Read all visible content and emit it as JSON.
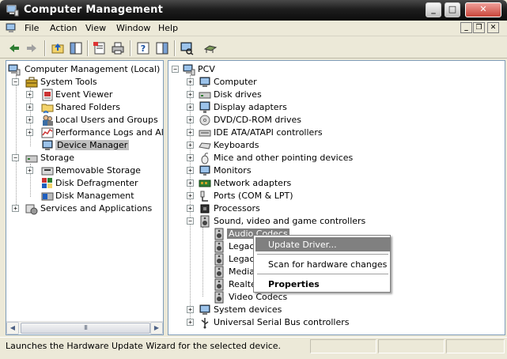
{
  "window": {
    "title": "Computer Management",
    "controls": {
      "minimize": "_",
      "maximize": "□",
      "close": "✕"
    }
  },
  "menubar": {
    "items": [
      "File",
      "Action",
      "View",
      "Window",
      "Help"
    ],
    "mdi_controls": {
      "minimize": "_",
      "restore": "❐",
      "close": "✕"
    }
  },
  "toolbar": {
    "buttons": [
      "back-icon",
      "forward-icon",
      "up-icon",
      "show-hide-tree-icon",
      "properties-icon",
      "print-icon",
      "help-icon",
      "action-pane-icon",
      "scan-hardware-icon",
      "remove-device-icon"
    ]
  },
  "left_tree": {
    "nodes": [
      {
        "label": "Computer Management (Local)",
        "icon": "computer-management-icon"
      },
      {
        "label": "System Tools",
        "icon": "toolbox-icon"
      },
      {
        "label": "Event Viewer",
        "icon": "event-viewer-icon"
      },
      {
        "label": "Shared Folders",
        "icon": "shared-folder-icon"
      },
      {
        "label": "Local Users and Groups",
        "icon": "users-icon"
      },
      {
        "label": "Performance Logs and Alerts",
        "icon": "performance-icon"
      },
      {
        "label": "Device Manager",
        "icon": "device-manager-icon",
        "selected": true
      },
      {
        "label": "Storage",
        "icon": "storage-icon"
      },
      {
        "label": "Removable Storage",
        "icon": "removable-storage-icon"
      },
      {
        "label": "Disk Defragmenter",
        "icon": "defragmenter-icon"
      },
      {
        "label": "Disk Management",
        "icon": "disk-management-icon"
      },
      {
        "label": "Services and Applications",
        "icon": "services-icon"
      }
    ]
  },
  "right_tree": {
    "root": "PCV",
    "nodes": [
      {
        "label": "Computer",
        "icon": "computer-icon"
      },
      {
        "label": "Disk drives",
        "icon": "disk-drive-icon"
      },
      {
        "label": "Display adapters",
        "icon": "display-adapter-icon"
      },
      {
        "label": "DVD/CD-ROM drives",
        "icon": "cdrom-icon"
      },
      {
        "label": "IDE ATA/ATAPI controllers",
        "icon": "ide-controller-icon"
      },
      {
        "label": "Keyboards",
        "icon": "keyboard-icon"
      },
      {
        "label": "Mice and other pointing devices",
        "icon": "mouse-icon"
      },
      {
        "label": "Monitors",
        "icon": "monitor-icon"
      },
      {
        "label": "Network adapters",
        "icon": "network-adapter-icon"
      },
      {
        "label": "Ports (COM & LPT)",
        "icon": "port-icon"
      },
      {
        "label": "Processors",
        "icon": "processor-icon"
      },
      {
        "label": "Sound, video and game controllers",
        "icon": "speaker-icon",
        "expanded": true
      },
      {
        "label": "System devices",
        "icon": "system-device-icon"
      },
      {
        "label": "Universal Serial Bus controllers",
        "icon": "usb-icon"
      }
    ],
    "sound_children": [
      "Audio Codecs",
      "Legacy",
      "Legacy",
      "Media",
      "Realte",
      "Video Codecs"
    ]
  },
  "context_menu": {
    "items": [
      {
        "label": "Update Driver...",
        "highlighted": true
      },
      {
        "label": "Scan for hardware changes"
      },
      {
        "label": "Properties",
        "bold": true
      }
    ]
  },
  "statusbar": {
    "text": "Launches the Hardware Update Wizard for the selected device."
  },
  "scrollbar": {
    "thumb_grip": "III"
  },
  "colors": {
    "title_bar": "#1e1e1e",
    "selection": "#808080",
    "window_bg": "#ece9d8"
  }
}
